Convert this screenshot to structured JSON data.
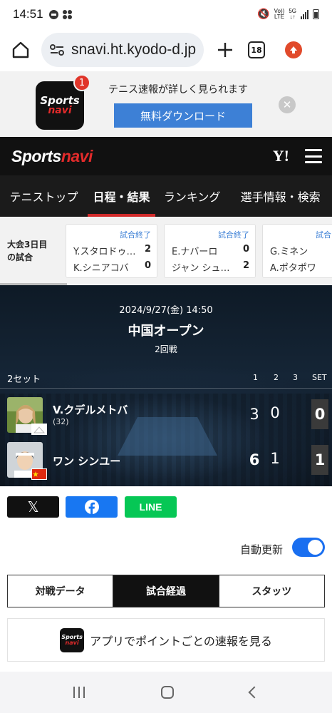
{
  "status_bar": {
    "time": "14:51",
    "network_top": "Vo))",
    "network_bottom": "LTE",
    "gen_top": "5G",
    "gen_bottom": "↓↑"
  },
  "browser": {
    "url": "snavi.ht.kyodo-d.jp",
    "tab_count": "18"
  },
  "app_banner": {
    "logo_line1": "Sports",
    "logo_line2": "navi",
    "badge": "1",
    "headline": "テニス速報が詳しく見られます",
    "download_label": "無料ダウンロード",
    "close_glyph": "✕"
  },
  "site_header": {
    "logo_white": "Sports",
    "logo_red": "navi",
    "yahoo": "Y!"
  },
  "nav_tabs": [
    {
      "label": "テニストップ",
      "active": false
    },
    {
      "label": "日程・結果",
      "active": true
    },
    {
      "label": "ランキング",
      "active": false
    },
    {
      "label": "選手情報・検索",
      "active": false
    }
  ],
  "day_strip": {
    "label_line1": "大会3日目",
    "label_line2": "の試合",
    "matches": [
      {
        "status": "試合終了",
        "p1": "Y.スタロドゥ…",
        "s1": "2",
        "p2": "K.シニアコバ",
        "s2": "0"
      },
      {
        "status": "試合終了",
        "p1": "E.ナバーロ",
        "s1": "0",
        "p2": "ジャン シュ…",
        "s2": "2"
      },
      {
        "status": "試合",
        "p1": "G.ミネン",
        "s1": "",
        "p2": "A.ポタポワ",
        "s2": ""
      }
    ]
  },
  "scoreboard": {
    "datetime": "2024/9/27(金) 14:50",
    "tournament": "中国オープン",
    "round": "2回戦",
    "format": "2セット",
    "col_headers": [
      "1",
      "2",
      "3",
      "SET"
    ],
    "players": [
      {
        "name": "V.クデルメトバ",
        "seed": "(32)",
        "sets": [
          "3",
          "0",
          ""
        ],
        "total": "0",
        "winner": false
      },
      {
        "name": "ワン シンユー",
        "seed": "",
        "sets": [
          "6",
          "1",
          ""
        ],
        "total": "1",
        "winner": true
      }
    ]
  },
  "share": {
    "x": "𝕏",
    "facebook": "f",
    "line": "LINE"
  },
  "auto_update": {
    "label": "自動更新",
    "enabled": true
  },
  "segment_tabs": [
    {
      "label": "対戦データ",
      "active": false
    },
    {
      "label": "試合経過",
      "active": true
    },
    {
      "label": "スタッツ",
      "active": false
    }
  ],
  "app_promo": {
    "logo_line1": "Sports",
    "logo_line2": "navi",
    "text": "アプリでポイントごとの速報を見る"
  },
  "colors": {
    "accent_red": "#d22b2b",
    "banner_blue": "#3d80d6",
    "toggle_blue": "#1a6ff0",
    "line_green": "#06c755",
    "facebook_blue": "#1877f2"
  }
}
